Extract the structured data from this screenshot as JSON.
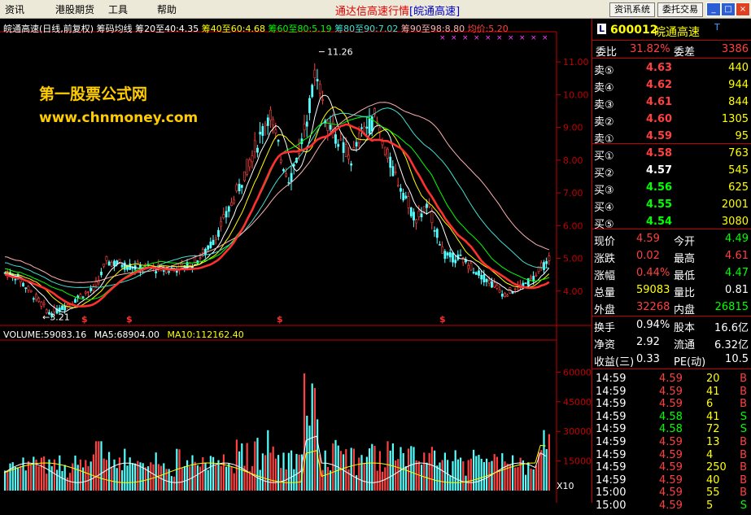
{
  "menubar": {
    "items": [
      "资讯",
      "港股期货",
      "工具",
      "帮助"
    ],
    "title_main": "通达信高速行情",
    "title_sub": "[皖通高速]",
    "btn_news": "资讯系统",
    "btn_trade": "委托交易",
    "win_min": "_",
    "win_max": "□",
    "win_close": "×"
  },
  "chart_header": {
    "title": "皖通高速(日线,前复权) 筹码均线",
    "ma_labels": [
      {
        "text": "筹20至40:4.35",
        "color": "#ffffff"
      },
      {
        "text": "筹40至60:4.68",
        "color": "#ffff00"
      },
      {
        "text": "筹60至80:5.19",
        "color": "#00ff00"
      },
      {
        "text": "筹80至90:7.02",
        "color": "#40e0d0"
      },
      {
        "text": "筹90至98:8.80",
        "color": "#ffb0b0"
      },
      {
        "text": "均价:5.20",
        "color": "#ff4040"
      }
    ]
  },
  "watermark": {
    "line1": "第一股票公式网",
    "line2": "www.chnmoney.com"
  },
  "price_axis": {
    "labels": [
      "11.00",
      "10.00",
      "9.00",
      "8.00",
      "7.00",
      "6.00",
      "5.00",
      "4.00"
    ],
    "high_marker": "11.26",
    "low_marker": "3.21",
    "signal_mark": "$"
  },
  "volume_header": {
    "volume": "VOLUME:59083.16",
    "ma5": "MA5:68904.00",
    "ma10": "MA10:112162.40"
  },
  "volume_axis": {
    "labels": [
      "60000",
      "45000",
      "30000",
      "15000"
    ],
    "unit": "X10"
  },
  "quote": {
    "code": "600012",
    "name": "皖通高速",
    "badge": "T",
    "weibi_label": "委比",
    "weibi": "31.82%",
    "weicha_label": "委差",
    "weicha": "3386",
    "asks": [
      {
        "label": "卖⑤",
        "price": "4.63",
        "vol": "440"
      },
      {
        "label": "卖④",
        "price": "4.62",
        "vol": "944"
      },
      {
        "label": "卖③",
        "price": "4.61",
        "vol": "844"
      },
      {
        "label": "卖②",
        "price": "4.60",
        "vol": "1305"
      },
      {
        "label": "卖①",
        "price": "4.59",
        "vol": "95"
      }
    ],
    "bids": [
      {
        "label": "买①",
        "price": "4.58",
        "vol": "763"
      },
      {
        "label": "买②",
        "price": "4.57",
        "vol": "545"
      },
      {
        "label": "买③",
        "price": "4.56",
        "vol": "625"
      },
      {
        "label": "买④",
        "price": "4.55",
        "vol": "2001"
      },
      {
        "label": "买⑤",
        "price": "4.54",
        "vol": "3080"
      }
    ],
    "stats": [
      {
        "l1": "现价",
        "v1": "4.59",
        "c1": "#ff4040",
        "l2": "今开",
        "v2": "4.49",
        "c2": "#00ff00"
      },
      {
        "l1": "涨跌",
        "v1": "0.02",
        "c1": "#ff4040",
        "l2": "最高",
        "v2": "4.61",
        "c2": "#ff4040"
      },
      {
        "l1": "涨幅",
        "v1": "0.44%",
        "c1": "#ff4040",
        "l2": "最低",
        "v2": "4.47",
        "c2": "#00ff00"
      },
      {
        "l1": "总量",
        "v1": "59083",
        "c1": "#ffff00",
        "l2": "量比",
        "v2": "0.81",
        "c2": "#ffffff"
      },
      {
        "l1": "外盘",
        "v1": "32268",
        "c1": "#ff4040",
        "l2": "内盘",
        "v2": "26815",
        "c2": "#00ff00"
      }
    ],
    "stats2": [
      {
        "l1": "换手",
        "v1": "0.94%",
        "l2": "股本",
        "v2": "16.6亿"
      },
      {
        "l1": "净资",
        "v1": "2.92",
        "l2": "流通",
        "v2": "6.32亿"
      },
      {
        "l1": "收益(三)",
        "v1": "0.33",
        "l2": "PE(动)",
        "v2": "10.5"
      }
    ],
    "ticks": [
      {
        "time": "14:59",
        "price": "4.59",
        "vol": "20",
        "side": "B"
      },
      {
        "time": "14:59",
        "price": "4.59",
        "vol": "41",
        "side": "B"
      },
      {
        "time": "14:59",
        "price": "4.59",
        "vol": "6",
        "side": "B"
      },
      {
        "time": "14:59",
        "price": "4.58",
        "vol": "41",
        "side": "S"
      },
      {
        "time": "14:59",
        "price": "4.58",
        "vol": "72",
        "side": "S"
      },
      {
        "time": "14:59",
        "price": "4.59",
        "vol": "13",
        "side": "B"
      },
      {
        "time": "14:59",
        "price": "4.59",
        "vol": "4",
        "side": "B"
      },
      {
        "time": "14:59",
        "price": "4.59",
        "vol": "250",
        "side": "B"
      },
      {
        "time": "14:59",
        "price": "4.59",
        "vol": "40",
        "side": "B"
      },
      {
        "time": "15:00",
        "price": "4.59",
        "vol": "55",
        "side": "B"
      },
      {
        "time": "15:00",
        "price": "4.59",
        "vol": "5",
        "side": "S"
      }
    ]
  },
  "colors": {
    "up": "#ff4040",
    "down": "#54ffff",
    "grid": "#c00000",
    "yellow": "#ffff00",
    "green": "#00ff00"
  }
}
